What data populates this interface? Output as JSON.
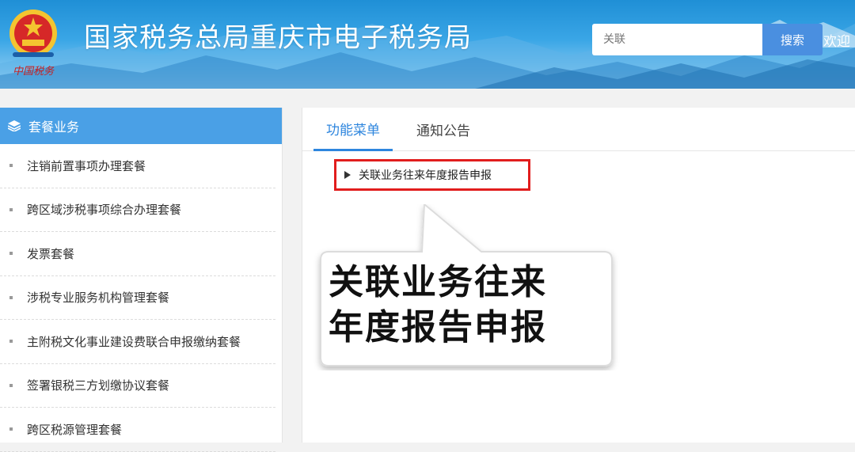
{
  "header": {
    "title": "国家税务总局重庆市电子税务局",
    "search_placeholder": "关联",
    "search_button": "搜索",
    "welcome": "欢迎",
    "emblem_text": "中国税务"
  },
  "sidebar": {
    "heading": "套餐业务",
    "items": [
      {
        "label": "注销前置事项办理套餐"
      },
      {
        "label": "跨区域涉税事项综合办理套餐"
      },
      {
        "label": "发票套餐"
      },
      {
        "label": "涉税专业服务机构管理套餐"
      },
      {
        "label": "主附税文化事业建设费联合申报缴纳套餐"
      },
      {
        "label": "签署银税三方划缴协议套餐"
      },
      {
        "label": "跨区税源管理套餐"
      }
    ]
  },
  "main": {
    "tabs": [
      {
        "label": "功能菜单",
        "active": true
      },
      {
        "label": "通知公告",
        "active": false
      }
    ],
    "menu_item": "关联业务往来年度报告申报"
  },
  "callout": {
    "line1": "关联业务往来",
    "line2": "年度报告申报"
  },
  "colors": {
    "accent": "#2e86de",
    "sidebar_header": "#4aa0e6",
    "highlight_border": "#e11d1d",
    "search_button": "#4a8fe0"
  }
}
